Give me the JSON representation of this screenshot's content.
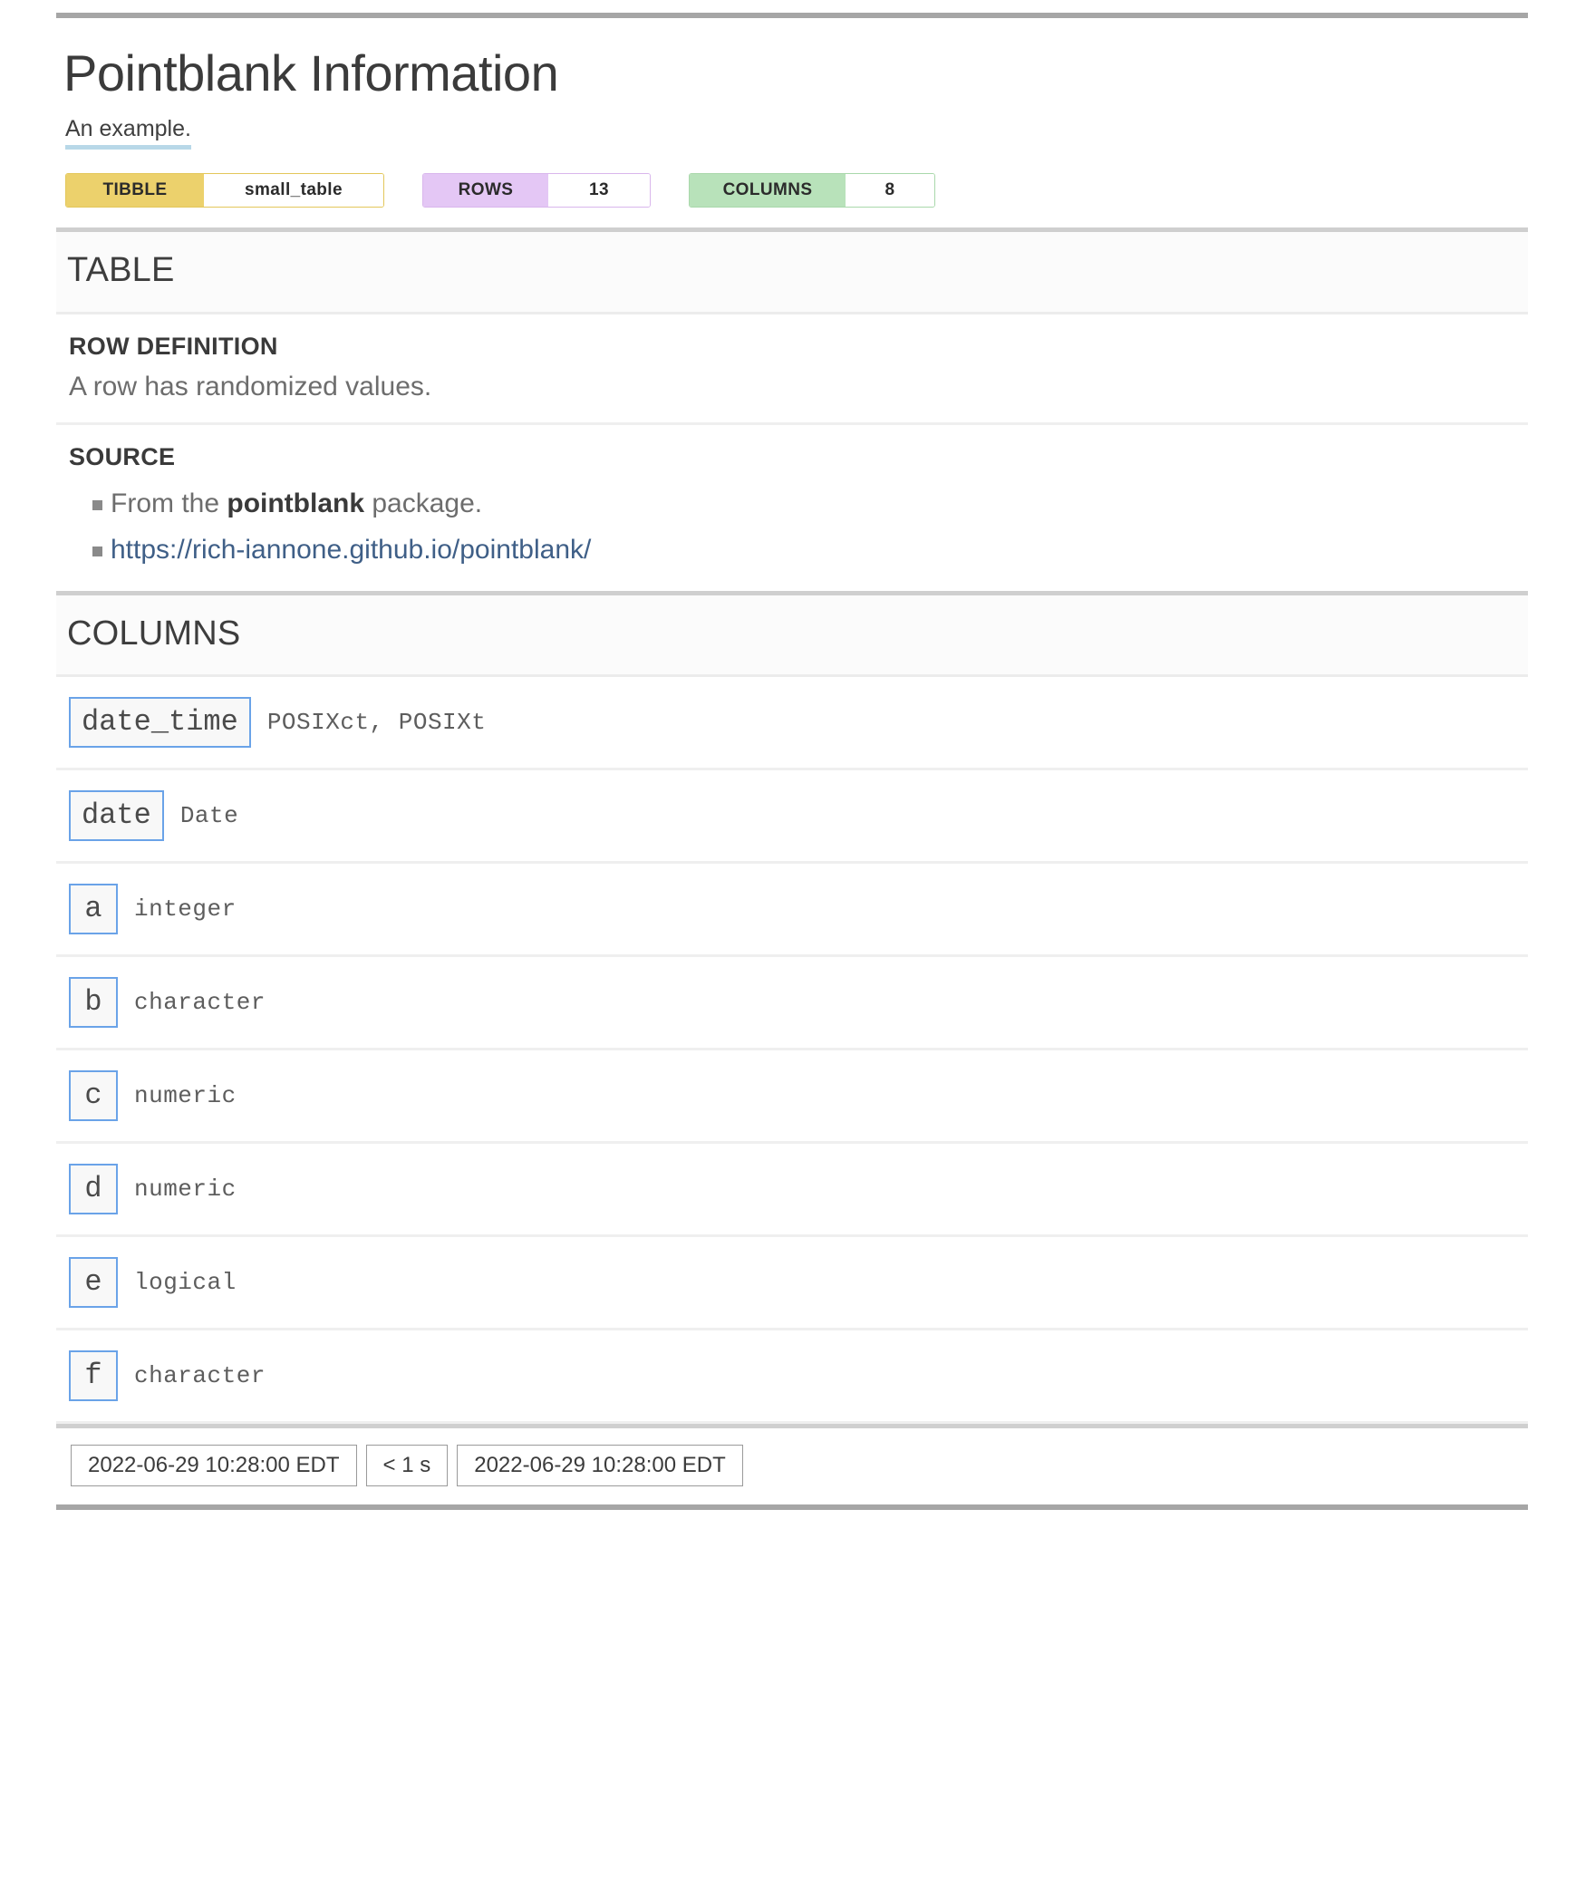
{
  "report": {
    "title": "Pointblank Information",
    "subtitle": "An example.",
    "badges": [
      {
        "label": "TIBBLE",
        "value": "small_table",
        "kind": "tibble"
      },
      {
        "label": "ROWS",
        "value": "13",
        "kind": "rows"
      },
      {
        "label": "COLUMNS",
        "value": "8",
        "kind": "columns"
      }
    ],
    "table_section": {
      "heading": "TABLE",
      "row_definition": {
        "title": "ROW DEFINITION",
        "text": "A row has randomized values."
      },
      "source": {
        "title": "SOURCE",
        "item_prefix": "From the ",
        "item_strong": "pointblank",
        "item_suffix": " package.",
        "link_text": "https://rich-iannone.github.io/pointblank/"
      }
    },
    "columns_section": {
      "heading": "COLUMNS",
      "rows": [
        {
          "name": "date_time",
          "type": "POSIXct, POSIXt"
        },
        {
          "name": "date",
          "type": "Date"
        },
        {
          "name": "a",
          "type": "integer"
        },
        {
          "name": "b",
          "type": "character"
        },
        {
          "name": "c",
          "type": "numeric"
        },
        {
          "name": "d",
          "type": "numeric"
        },
        {
          "name": "e",
          "type": "logical"
        },
        {
          "name": "f",
          "type": "character"
        }
      ]
    },
    "footer": {
      "start_time": "2022-06-29 10:28:00 EDT",
      "duration": "< 1 s",
      "end_time": "2022-06-29 10:28:00 EDT"
    }
  },
  "colors": {
    "tibble_badge": "#ecd16c",
    "rows_badge": "#e4c7f5",
    "columns_badge": "#b8e2ba",
    "column_box_border": "#6aa3e8",
    "link": "#3f5f87",
    "subtitle_underline": "#b8d8e8",
    "frame_border": "#a6a6a6"
  }
}
